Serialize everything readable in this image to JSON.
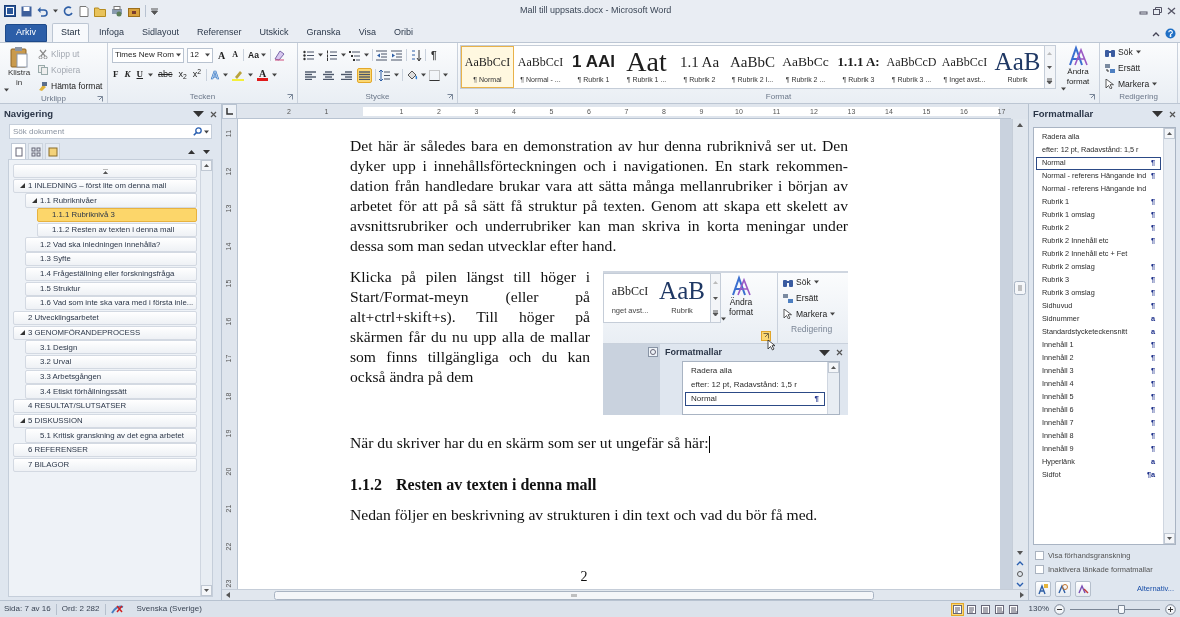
{
  "title_bar": {
    "title": "Mall till uppsats.docx  -  Microsoft Word"
  },
  "tabs": [
    {
      "label": "Arkiv",
      "kind": "file",
      "selected": false
    },
    {
      "label": "Start",
      "kind": "tab",
      "selected": true
    },
    {
      "label": "Infoga",
      "kind": "tab",
      "selected": false
    },
    {
      "label": "Sidlayout",
      "kind": "tab",
      "selected": false
    },
    {
      "label": "Referenser",
      "kind": "tab",
      "selected": false
    },
    {
      "label": "Utskick",
      "kind": "tab",
      "selected": false
    },
    {
      "label": "Granska",
      "kind": "tab",
      "selected": false
    },
    {
      "label": "Visa",
      "kind": "tab",
      "selected": false
    },
    {
      "label": "Oribi",
      "kind": "tab",
      "selected": false
    }
  ],
  "ribbon": {
    "clipboard": {
      "group": "Urklipp",
      "paste": "Klistra in",
      "actions": [
        {
          "label": "Klipp ut",
          "disabled": true
        },
        {
          "label": "Kopiera",
          "disabled": true
        },
        {
          "label": "Hämta format",
          "disabled": false
        }
      ]
    },
    "font": {
      "group": "Tecken",
      "name": "Times New Rom",
      "size": "12",
      "grow": "A",
      "shrink": "A",
      "change_case": "Aa",
      "style_buttons": [
        "F",
        "K",
        "U",
        "abc",
        "x$_{2}$",
        "x$^{2}$"
      ],
      "text_effects": "A",
      "font_color": "A"
    },
    "paragraph": {
      "group": "Stycke",
      "show_marks": "¶",
      "alignments": [
        {
          "selected": false
        },
        {
          "selected": false
        },
        {
          "selected": false
        },
        {
          "selected": true
        }
      ]
    },
    "styles": {
      "group": "Format",
      "change_styles": "Ändra format",
      "items": [
        {
          "preview": "AaBbCcI",
          "label": "¶ Normal",
          "kind": "body",
          "selected": true
        },
        {
          "preview": "AaBbCcI",
          "label": "¶ Normal - ...",
          "kind": "body",
          "selected": false
        },
        {
          "preview": "1 AAI",
          "label": "¶ Rubrik 1",
          "kind": "bold_sans",
          "selected": false
        },
        {
          "preview": "Aat",
          "label": "¶ Rubrik 1 ...",
          "kind": "large",
          "selected": false
        },
        {
          "preview": "1.1 Aa",
          "label": "¶ Rubrik 2",
          "kind": "medium",
          "selected": false
        },
        {
          "preview": "AaBbC",
          "label": "¶ Rubrik 2 I...",
          "kind": "medium",
          "selected": false
        },
        {
          "preview": "AaBbCc",
          "label": "¶ Rubrik 2 ...",
          "kind": "body_large",
          "selected": false
        },
        {
          "preview": "1.1.1 A:",
          "label": "¶ Rubrik 3",
          "kind": "bold_serif",
          "selected": false
        },
        {
          "preview": "AaBbCcD",
          "label": "¶ Rubrik 3 ...",
          "kind": "body",
          "selected": false
        },
        {
          "preview": "AaBbCcI",
          "label": "¶ Inget avst...",
          "kind": "body",
          "selected": false
        },
        {
          "preview": "AaB",
          "label": "Rubrik",
          "kind": "title",
          "selected": false
        }
      ]
    },
    "editing": {
      "group": "Redigering",
      "find": "Sök",
      "replace": "Ersätt",
      "select": "Markera"
    }
  },
  "navigation": {
    "title": "Navigering",
    "search": {
      "placeholder": "Sök dokument"
    },
    "view_tabs": [
      {
        "selected": true
      },
      {
        "selected": false
      },
      {
        "selected": false
      }
    ],
    "headings": [
      {
        "text": "1 INLEDNING – först lite om denna mall",
        "selected": false,
        "expanded": true,
        "children": [
          {
            "text": "1.1 Rubriknivåer",
            "selected": false,
            "expanded": true,
            "children": [
              {
                "text": "1.1.1 Rubriknivå 3",
                "selected": true
              },
              {
                "text": "1.1.2 Resten av texten i denna mall",
                "selected": false
              }
            ]
          },
          {
            "text": "1.2 Vad ska inledningen innehålla?",
            "selected": false
          },
          {
            "text": "1.3 Syfte",
            "selected": false
          },
          {
            "text": "1.4 Frågeställning eller forskningsfråga",
            "selected": false
          },
          {
            "text": "1.5 Struktur",
            "selected": false
          },
          {
            "text": "1.6 Vad som inte ska vara med i första inle...",
            "selected": false
          }
        ]
      },
      {
        "text": "2 Utvecklingsarbetet",
        "selected": false
      },
      {
        "text": "3 GENOMFÖRANDEPROCESS",
        "selected": false,
        "expanded": true,
        "children": [
          {
            "text": "3.1 Design",
            "selected": false
          },
          {
            "text": "3.2 Urval",
            "selected": false
          },
          {
            "text": "3.3 Arbetsgången",
            "selected": false
          },
          {
            "text": "3.4 Etiskt förhållningssätt",
            "selected": false
          }
        ]
      },
      {
        "text": "4 RESULTAT/SLUTSATSER",
        "selected": false
      },
      {
        "text": "5 DISKUSSION",
        "selected": false,
        "expanded": true,
        "children": [
          {
            "text": "5.1 Kritisk granskning av det egna arbetet",
            "selected": false
          }
        ]
      },
      {
        "text": "6 REFERENSER",
        "selected": false
      },
      {
        "text": "7 BILAGOR",
        "selected": false
      }
    ]
  },
  "ruler": {
    "horizontal": [
      "2",
      "1",
      "1",
      "2",
      "3",
      "4",
      "5",
      "6",
      "7",
      "8",
      "9",
      "10",
      "11",
      "12",
      "13",
      "14",
      "15",
      "16",
      "17"
    ],
    "vertical": [
      "11",
      "12",
      "13",
      "14",
      "15",
      "16",
      "17",
      "18",
      "19",
      "20",
      "21",
      "22",
      "23"
    ]
  },
  "document": {
    "blocks": [
      {
        "kind": "paragraph",
        "text": "Det här är således bara en demonstration av hur denna rubriknivå ser ut. Den dyker upp i innehållsförteckningen och i navigationen. En stark rekommen-dation från handledare brukar vara att sätta många mellanrubriker i början av arbetet för att på så sätt få struktur på texten. Genom att skapa ett skelett av avsnittsrubriker och underrubriker kan man skriva in korta meningar under dessa som man sedan utvecklar efter hand."
      },
      {
        "kind": "figure_paragraph",
        "text": "Klicka på pilen längst till höger i Start/Format-meyn (eller på alt+ctrl+skift+s). Till höger på skärmen får du nu upp alla de mallar som finns tillgängliga och du kan också ändra på dem"
      },
      {
        "kind": "paragraph",
        "text": "När du skriver har du en skärm som ser ut ungefär så här:",
        "cursor": true
      },
      {
        "kind": "heading",
        "number": "1.1.2",
        "text": "Resten av texten i denna mall"
      },
      {
        "kind": "paragraph",
        "text": "Nedan följer en beskrivning av strukturen i din text och vad du bör få med."
      }
    ],
    "figure": {
      "gallery": [
        {
          "preview": "aBbCcI",
          "label": "nget avst...",
          "kind": "body"
        },
        {
          "preview": "AaB",
          "label": "Rubrik",
          "kind": "title"
        }
      ],
      "change_styles": "Ändra format",
      "find": "Sök",
      "replace": "Ersätt",
      "select": "Markera",
      "group": "Redigering",
      "pane_title": "Formatmallar",
      "styles": [
        {
          "name": "Radera alla",
          "selected": false
        },
        {
          "name": "efter:  12 pt, Radavstånd:  1,5 r",
          "selected": false
        },
        {
          "name": "Normal",
          "mark": "¶",
          "selected": true
        }
      ]
    },
    "page_number": "2"
  },
  "styles_pane": {
    "title": "Formatmallar",
    "styles": [
      {
        "name": "Radera alla",
        "selected": false
      },
      {
        "name": "efter:  12 pt, Radavstånd:  1,5 r",
        "selected": false
      },
      {
        "name": "Normal",
        "mark": "¶",
        "selected": true
      },
      {
        "name": "Normal - referens Hängande ind",
        "mark": "¶",
        "selected": false
      },
      {
        "name": "Normal - referens Hängande ind",
        "selected": false
      },
      {
        "name": "Rubrik 1",
        "mark": "¶",
        "selected": false
      },
      {
        "name": "Rubrik 1 omslag",
        "mark": "¶",
        "selected": false
      },
      {
        "name": "Rubrik 2",
        "mark": "¶",
        "selected": false
      },
      {
        "name": "Rubrik 2 Innehåll etc",
        "mark": "¶",
        "selected": false
      },
      {
        "name": "Rubrik 2 Innehåll etc + Fet",
        "selected": false
      },
      {
        "name": "Rubrik 2 omslag",
        "mark": "¶",
        "selected": false
      },
      {
        "name": "Rubrik 3",
        "mark": "¶",
        "selected": false
      },
      {
        "name": "Rubrik 3 omslag",
        "mark": "¶",
        "selected": false
      },
      {
        "name": "Sidhuvud",
        "mark": "¶",
        "selected": false
      },
      {
        "name": "Sidnummer",
        "mark": "a",
        "selected": false
      },
      {
        "name": "Standardstycketeckensnitt",
        "mark": "a",
        "selected": false
      },
      {
        "name": "Innehåll 1",
        "mark": "¶",
        "selected": false
      },
      {
        "name": "Innehåll 2",
        "mark": "¶",
        "selected": false
      },
      {
        "name": "Innehåll 3",
        "mark": "¶",
        "selected": false
      },
      {
        "name": "Innehåll 4",
        "mark": "¶",
        "selected": false
      },
      {
        "name": "Innehåll 5",
        "mark": "¶",
        "selected": false
      },
      {
        "name": "Innehåll 6",
        "mark": "¶",
        "selected": false
      },
      {
        "name": "Innehåll 7",
        "mark": "¶",
        "selected": false
      },
      {
        "name": "Innehåll 8",
        "mark": "¶",
        "selected": false
      },
      {
        "name": "Innehåll 9",
        "mark": "¶",
        "selected": false
      },
      {
        "name": "Hyperlänk",
        "mark": "a",
        "selected": false
      },
      {
        "name": "Sidfot",
        "mark": "¶a",
        "selected": false
      }
    ],
    "options": [
      {
        "label": "Visa förhandsgranskning",
        "checked": false
      },
      {
        "label": "Inaktivera länkade formatmallar",
        "checked": false
      }
    ],
    "options_link": "Alternativ..."
  },
  "status_bar": {
    "page": "Sida: 7 av 16",
    "words": "Ord: 2 282",
    "language": "Svenska (Sverige)",
    "views": [
      {
        "selected": true
      },
      {
        "selected": false
      },
      {
        "selected": false
      },
      {
        "selected": false
      },
      {
        "selected": false
      }
    ],
    "zoom": "130%",
    "zoom_slider": {
      "level": 0.57
    }
  }
}
